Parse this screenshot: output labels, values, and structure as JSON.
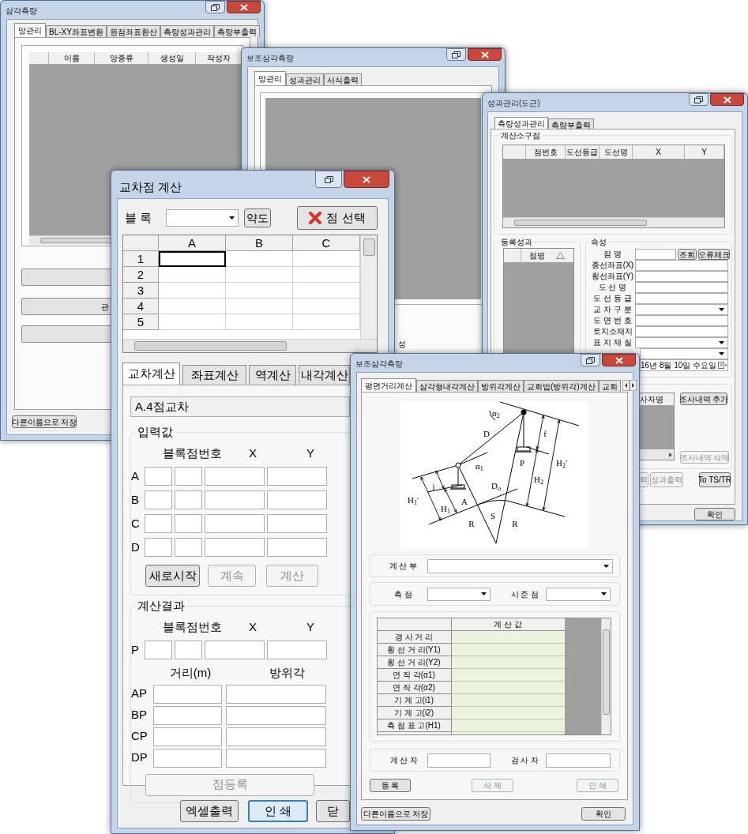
{
  "window_1": {
    "title": "삼각측량",
    "tabs": [
      {
        "label": "망관리",
        "selected": true
      },
      {
        "label": "BL-XY좌표변환",
        "selected": false
      },
      {
        "label": "원점좌표환산",
        "selected": false
      },
      {
        "label": "측량성과관리",
        "selected": false
      },
      {
        "label": "측량부출력",
        "selected": false
      }
    ],
    "table": {
      "columns": [
        "이름",
        "망종류",
        "생성일",
        "작성자"
      ]
    },
    "action_buttons": [
      {
        "kind": "blank"
      },
      {
        "kind": "text",
        "label": "관"
      },
      {
        "kind": "blank"
      }
    ],
    "save_button": "다른이름으로 저장"
  },
  "window_2": {
    "title": "보조삼각측량",
    "tabs": [
      {
        "label": "망관리",
        "selected": true
      },
      {
        "label": "성과관리",
        "selected": false
      },
      {
        "label": "서식출력",
        "selected": false
      }
    ],
    "fragment": "성"
  },
  "window_3": {
    "title": "성과관리(도근)",
    "tabs": [
      {
        "label": "측량성과관리",
        "selected": true
      },
      {
        "label": "측량부출력",
        "selected": false
      }
    ],
    "calc_points": {
      "title": "계산소구점",
      "columns": [
        "점번호",
        "도선등급",
        "도선명",
        "X",
        "Y"
      ]
    },
    "registered": {
      "title": "등록성과",
      "column": "점명"
    },
    "attributes": {
      "title": "속성",
      "lookup_buttons": [
        "조회",
        "오류체크"
      ],
      "rows": [
        {
          "label": "점 명",
          "kind": "lookup"
        },
        {
          "label": "종선좌표(X)",
          "kind": "text"
        },
        {
          "label": "횡선좌표(Y)",
          "kind": "text"
        },
        {
          "label": "도 선 명",
          "kind": "text"
        },
        {
          "label": "도 선 등 급",
          "kind": "text"
        },
        {
          "label": "교 차 구 분",
          "kind": "combo"
        },
        {
          "label": "도 면 번 호",
          "kind": "text"
        },
        {
          "label": "토지소재지",
          "kind": "text"
        },
        {
          "label": "표 지 재 질",
          "kind": "combo"
        },
        {
          "kind": "combo"
        },
        {
          "kind": "date",
          "value": "16년 8월 10일 수요일"
        }
      ]
    },
    "survey": {
      "column": "사자명",
      "add_button": {
        "label": "조사내역 추가",
        "disabled": false
      },
      "delete_button": {
        "label": "조사내역 삭제",
        "disabled": true
      }
    },
    "bottom_buttons": [
      {
        "label": "력",
        "disabled": true
      },
      {
        "label": "성과출력",
        "disabled": true
      },
      {
        "label": "To TS/TR",
        "disabled": false
      }
    ],
    "ok_button": "확인"
  },
  "window_4": {
    "title": "교차점 계산",
    "block_label": "블 록",
    "sketch_button": "약도",
    "select_button": "점 선택",
    "grid": {
      "columns": [
        "A",
        "B",
        "C"
      ],
      "rows": [
        {
          "label": "1",
          "active": true
        },
        {
          "label": "2",
          "active": false
        },
        {
          "label": "3",
          "active": false
        },
        {
          "label": "4",
          "active": false
        },
        {
          "label": "5",
          "active": false
        }
      ]
    },
    "tabs": [
      {
        "label": "교차계산",
        "selected": true
      },
      {
        "label": "좌표계산",
        "selected": false
      },
      {
        "label": "역계산",
        "selected": false
      },
      {
        "label": "내각계산",
        "selected": false
      }
    ],
    "method": "A.4점교차",
    "input": {
      "title": "입력값",
      "headers": [
        "블록점번호",
        "X",
        "Y"
      ],
      "rows": [
        "A",
        "B",
        "C",
        "D"
      ],
      "buttons": [
        {
          "label": "새로시작",
          "disabled": false
        },
        {
          "label": "계속",
          "disabled": true
        },
        {
          "label": "계산",
          "disabled": true
        }
      ]
    },
    "result": {
      "title": "계산결과",
      "headers": [
        "블록점번호",
        "X",
        "Y"
      ],
      "point": "P",
      "distance_headers": [
        "거리(m)",
        "방위각"
      ],
      "rows": [
        "AP",
        "BP",
        "CP",
        "DP"
      ],
      "register_button": {
        "label": "점등록",
        "disabled": true
      }
    },
    "bottom_buttons": [
      {
        "label": "엑셀출력",
        "focused": false
      },
      {
        "label": "인 쇄",
        "focused": true
      },
      {
        "label": "닫",
        "focused": false
      }
    ]
  },
  "window_5": {
    "title": "보조삼각측량",
    "tabs": [
      {
        "label": "평면거리계산",
        "selected": true
      },
      {
        "label": "삼각형내각계산",
        "selected": false
      },
      {
        "label": "방위각계산",
        "selected": false
      },
      {
        "label": "교회법(방위각)계산",
        "selected": false
      },
      {
        "label": "교회",
        "selected": false
      }
    ],
    "diagram_labels": [
      "α$_{2}$",
      "D",
      "α$_{1}$",
      "i",
      "H$_{1}$'",
      "H$_{1}$",
      "A",
      "D$_{o}$",
      "S",
      "R",
      "R",
      "P",
      "f",
      "H$_{2}$",
      "H$_{2}$'"
    ],
    "calc_label": "계 산 부",
    "station_label": "측 점",
    "target_label": "시 준 점",
    "table": {
      "header": "계 산 값",
      "rows": [
        "경 사 거 리",
        "횡 선 거 리(Y1)",
        "횡 선 거 리(Y2)",
        "연 직 각(α1)",
        "연 직 각(α2)",
        "기 계 고(i1)",
        "기 계 고(i2)",
        "측 점 표 고(H1)"
      ]
    },
    "calculator_label": "계 산 자",
    "checker_label": "검 사 자",
    "actions": [
      {
        "label": "등 록",
        "disabled": false
      },
      {
        "label": "삭 제",
        "disabled": true
      },
      {
        "label": "인 쇄",
        "disabled": true
      }
    ],
    "save_button": "다른이름으로 저장",
    "ok_button": "확인"
  }
}
